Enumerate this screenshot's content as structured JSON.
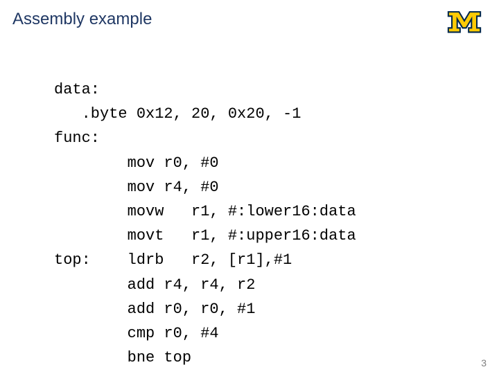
{
  "title": "Assembly example",
  "page_number": "3",
  "logo": {
    "name": "block-m-logo",
    "fill": "#FFCB05",
    "stroke": "#00274C"
  },
  "code_lines": [
    "data:",
    "   .byte 0x12, 20, 0x20, -1",
    "func:",
    "        mov r0, #0",
    "        mov r4, #0",
    "        movw   r1, #:lower16:data",
    "        movt   r1, #:upper16:data",
    "top:    ldrb   r2, [r1],#1",
    "        add r4, r4, r2",
    "        add r0, r0, #1",
    "        cmp r0, #4",
    "        bne top"
  ]
}
